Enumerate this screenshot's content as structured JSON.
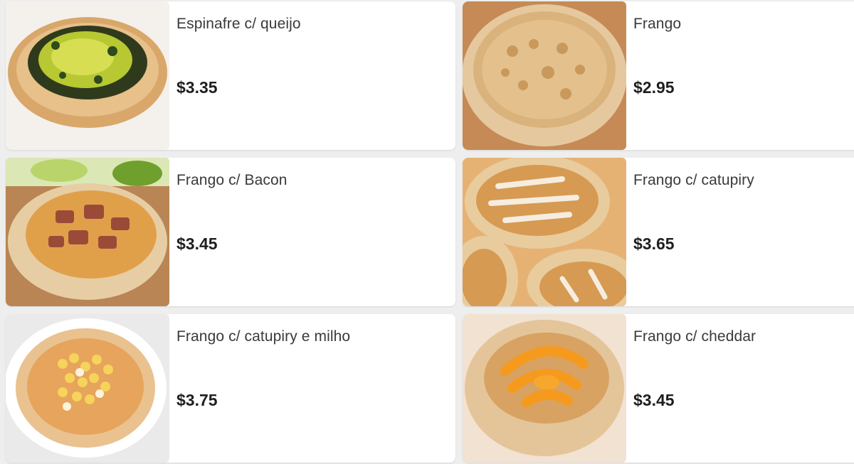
{
  "menu": {
    "items": [
      {
        "name": "Espinafre c/ queijo",
        "price": "$3.35"
      },
      {
        "name": "Frango",
        "price": "$2.95"
      },
      {
        "name": "Frango c/ Bacon",
        "price": "$3.45"
      },
      {
        "name": "Frango c/ catupiry",
        "price": "$3.65"
      },
      {
        "name": "Frango c/ catupiry e milho",
        "price": "$3.75"
      },
      {
        "name": "Frango c/ cheddar",
        "price": "$3.45"
      }
    ]
  }
}
